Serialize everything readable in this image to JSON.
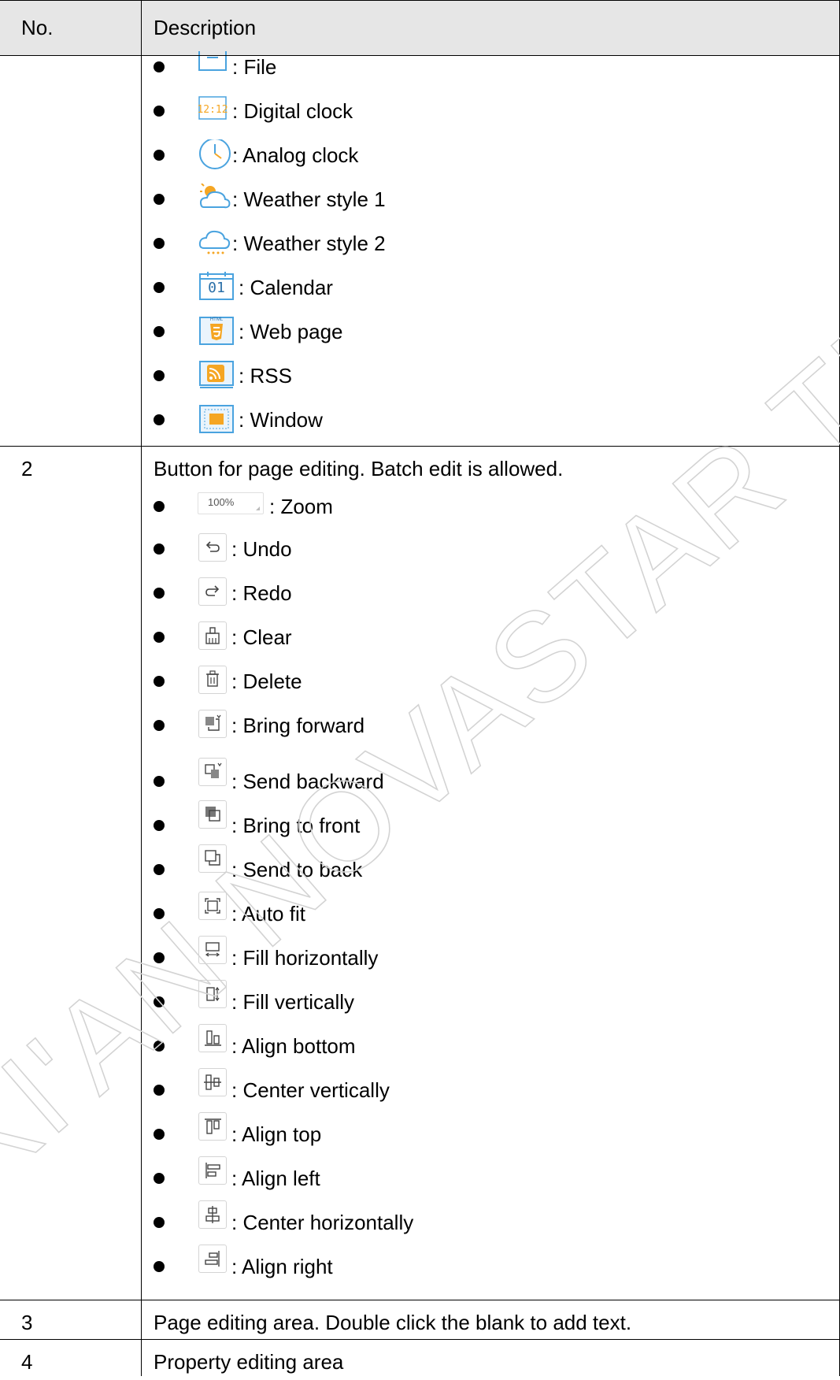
{
  "table": {
    "headers": {
      "no": "No.",
      "description": "Description"
    },
    "rows": [
      {
        "no": "",
        "items": [
          {
            "icon": "file-icon",
            "label": ": File"
          },
          {
            "icon": "digital-clock-icon",
            "label": ": Digital clock"
          },
          {
            "icon": "analog-clock-icon",
            "label": ": Analog clock"
          },
          {
            "icon": "weather-style-1-icon",
            "label": ": Weather style 1"
          },
          {
            "icon": "weather-style-2-icon",
            "label": ": Weather style 2"
          },
          {
            "icon": "calendar-icon",
            "label": ": Calendar",
            "icon_text": "01"
          },
          {
            "icon": "web-page-icon",
            "label": ": Web page",
            "icon_text": "HTML"
          },
          {
            "icon": "rss-icon",
            "label": ": RSS"
          },
          {
            "icon": "window-icon",
            "label": ": Window"
          }
        ]
      },
      {
        "no": "2",
        "intro": "Button for page editing. Batch edit is allowed.",
        "items": [
          {
            "icon": "zoom-select-icon",
            "label": ": Zoom",
            "icon_text": "100%"
          },
          {
            "icon": "undo-icon",
            "label": ": Undo"
          },
          {
            "icon": "redo-icon",
            "label": ": Redo"
          },
          {
            "icon": "clear-icon",
            "label": ": Clear"
          },
          {
            "icon": "delete-icon",
            "label": ": Delete"
          },
          {
            "icon": "bring-forward-icon",
            "label": ": Bring forward"
          },
          {
            "icon": "send-backward-icon",
            "label": ": Send backward"
          },
          {
            "icon": "bring-to-front-icon",
            "label": ": Bring to front"
          },
          {
            "icon": "send-to-back-icon",
            "label": ": Send to back"
          },
          {
            "icon": "auto-fit-icon",
            "label": ": Auto fit"
          },
          {
            "icon": "fill-horizontally-icon",
            "label": ": Fill horizontally"
          },
          {
            "icon": "fill-vertically-icon",
            "label": ": Fill vertically"
          },
          {
            "icon": "align-bottom-icon",
            "label": ": Align bottom"
          },
          {
            "icon": "center-vertically-icon",
            "label": ": Center vertically"
          },
          {
            "icon": "align-top-icon",
            "label": ": Align top"
          },
          {
            "icon": "align-left-icon",
            "label": ": Align left"
          },
          {
            "icon": "center-horizontally-icon",
            "label": ": Center horizontally"
          },
          {
            "icon": "align-right-icon",
            "label": ": Align right"
          }
        ]
      },
      {
        "no": "3",
        "text": "Page editing area. Double click the blank to add text."
      },
      {
        "no": "4",
        "text": "Property editing area"
      }
    ]
  },
  "watermark": {
    "text": "XI'AN NOVASTAR TECH CO.,LTD"
  },
  "colors": {
    "header_bg": "#e6e6e6",
    "icon_blue": "#4aa3df",
    "icon_orange": "#f5a623",
    "icon_gray": "#666666",
    "border": "#000000"
  }
}
